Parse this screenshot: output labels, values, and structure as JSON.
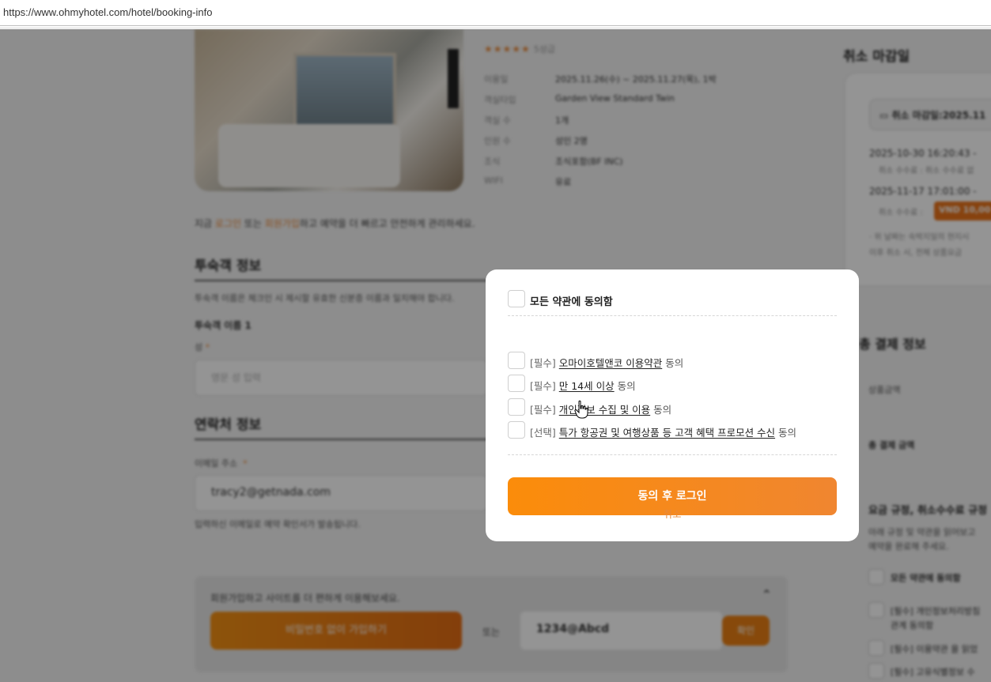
{
  "browser": {
    "url": "https://www.ohmyhotel.com/hotel/booking-info"
  },
  "hotel": {
    "rating_label": "5성급",
    "info_rows": [
      {
        "key": "이용일",
        "value": "2025.11.26(수) ~ 2025.11.27(목), 1박"
      },
      {
        "key": "객실타입",
        "value": "Garden View Standard Twin"
      },
      {
        "key": "객실 수",
        "value": "1개"
      },
      {
        "key": "인원 수",
        "value": "성인 2명"
      },
      {
        "key": "조식",
        "value": "조식포함(BF INC)"
      },
      {
        "key": "WIFI",
        "value": "유료"
      }
    ]
  },
  "login_hint": {
    "pre": "지금 ",
    "login": "로그인",
    "mid": " 또는 ",
    "signup": "회원가입",
    "post": "하고 예약을 더 빠르고 안전하게 관리하세요."
  },
  "guest": {
    "title": "투숙객 정보",
    "desc": "투숙객 이름은 체크인 시 제시할 유효한 신분증 이름과 일치해야 합니다.",
    "guest1": "투숙객 이름 1",
    "last_name_label": "성",
    "last_name_placeholder": "영문 성 입력"
  },
  "contact": {
    "title": "연락처 정보",
    "email_label": "이메일 주소",
    "email_value": "tracy2@getnada.com",
    "email_note": "입력하신 이메일로 예약 확인서가 발송됩니다."
  },
  "member": {
    "text": "회원가입하고 사이트를 더 편하게 이용해보세요.",
    "signup_button": "비밀번호 없이 가입하기",
    "or": "또는",
    "password_value": "1234@Abcd",
    "confirm_button": "확인"
  },
  "right": {
    "cancel_title": "취소 마감일",
    "deadline_chip": "취소 마감일:2025.11",
    "items": [
      {
        "date": "2025-10-30 16:20:43 -",
        "fee": "취소 수수료 : 취소 수수료 없"
      },
      {
        "date": "2025-11-17 17:01:00 -",
        "fee": "취소 수수료 :"
      }
    ],
    "vnd_badge": "VND 10,00",
    "note1": "· 위 날짜는 숙박지일의 현지시",
    "note2": "이후 취소 시, 전체 상품요금",
    "payment_title": "총 결제 정보",
    "product_amount": "상품금액",
    "total_amount": "총 결제 금액",
    "rules_title": "요금 규정, 취소수수료 규정",
    "rules_desc1": "아래 규정 및 약관을 읽어보고",
    "rules_desc2": "예약을 완료해 주세요.",
    "agree_all": "모든 약관에 동의함",
    "req1": "[필수] 개인정보처리방침",
    "req1b": "관계 동의함",
    "req2": "[필수] 이용약관 을 읽었",
    "req3": "[필수] 고유식별정보 수"
  },
  "modal": {
    "agree_all_label": "모든 약관에 동의함",
    "terms": [
      {
        "tag": "[필수]",
        "link": "오마이호텔앤코 이용약관",
        "suffix": " 동의"
      },
      {
        "tag": "[필수]",
        "link": "만 14세 이상",
        "suffix": " 동의"
      },
      {
        "tag": "[필수]",
        "link": "개인정보 수집 및 이용",
        "suffix": " 동의"
      },
      {
        "tag": "[선택]",
        "link": "특가 항공권 및 여행상품 등 고객 혜택 프로모션 수신",
        "suffix": " 동의"
      }
    ],
    "primary_button": "동의 후 로그인",
    "cancel_button": "취소"
  },
  "colors": {
    "accent": "#F08A24",
    "primary_start": "#FB8C0A",
    "primary_end": "#F08630"
  }
}
